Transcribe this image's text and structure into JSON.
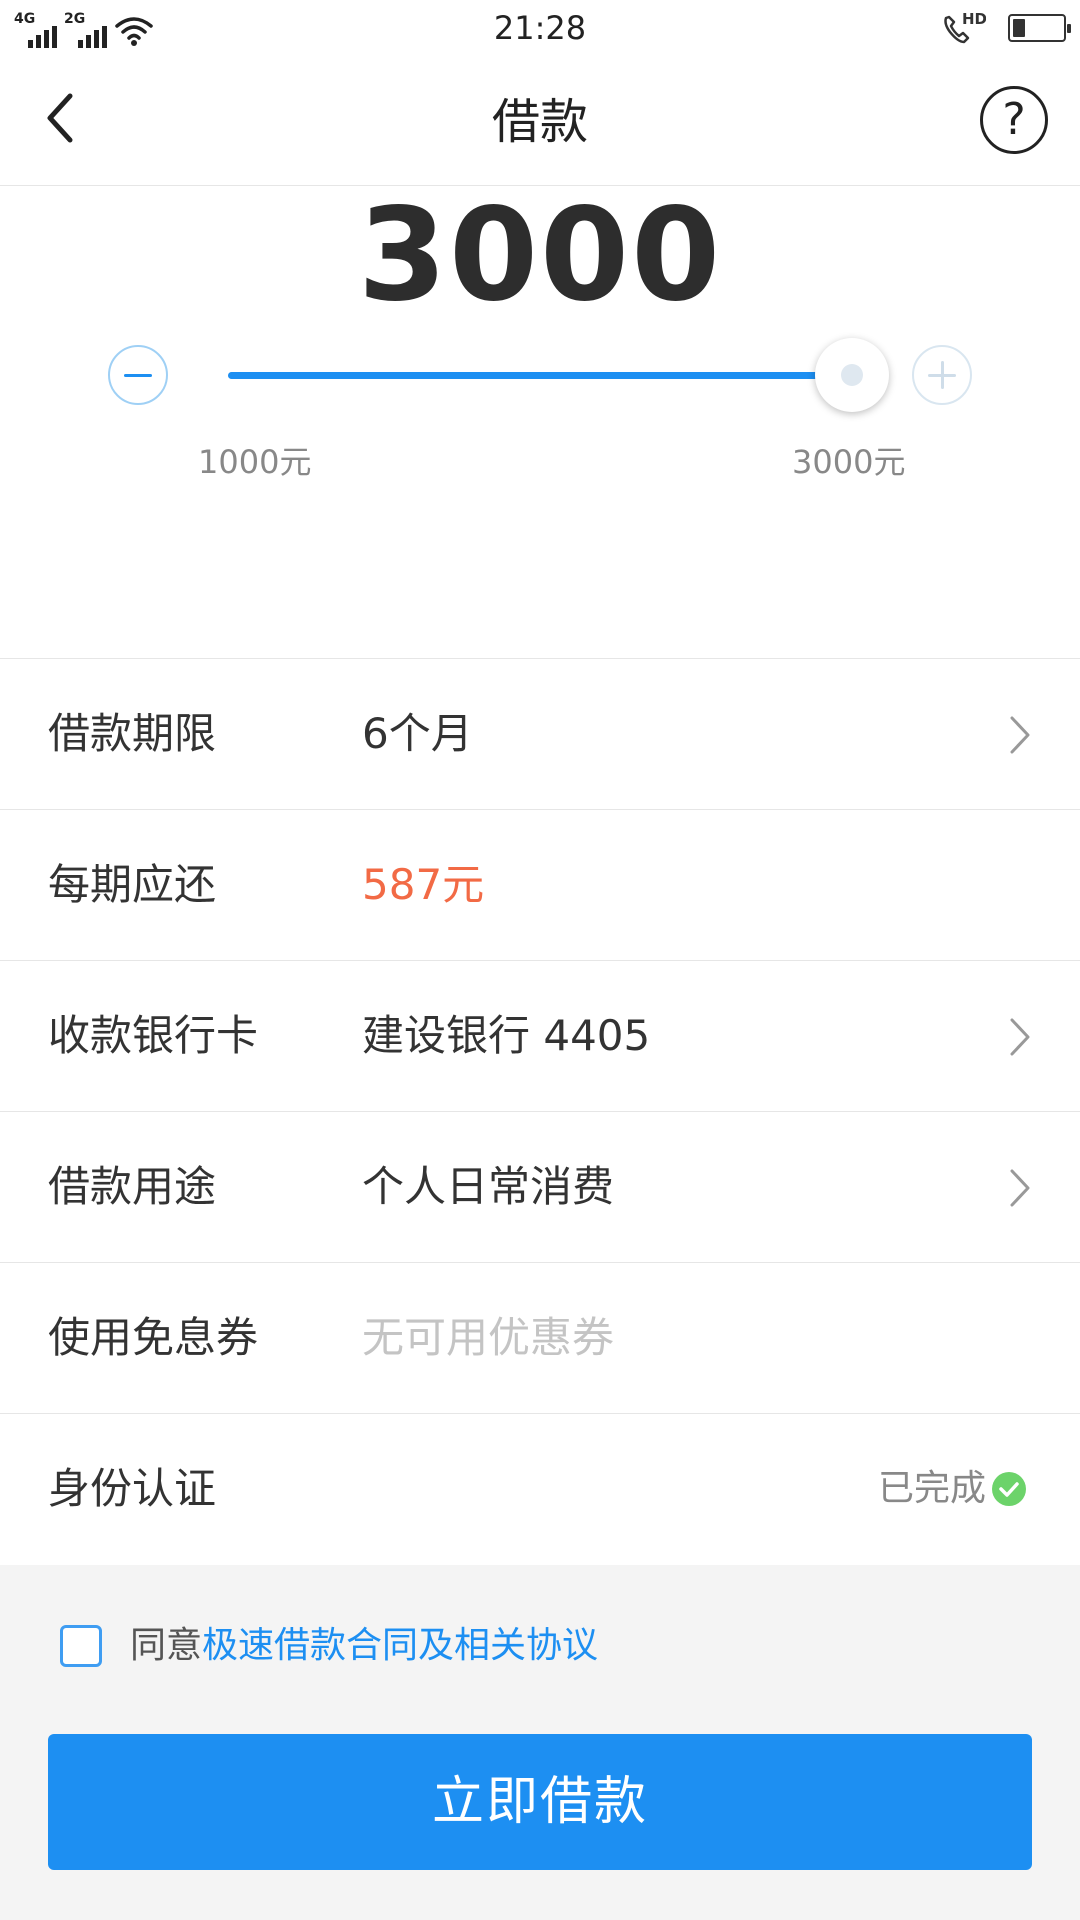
{
  "status_bar": {
    "network1": "4G",
    "network2": "2G",
    "time": "21:28",
    "hd_label": "HD",
    "battery_level": 0.25,
    "icons": [
      "signal-4g-icon",
      "signal-2g-icon",
      "wifi-icon",
      "hd-call-icon",
      "battery-icon"
    ]
  },
  "nav": {
    "back_icon": "chevron-left-icon",
    "title": "借款",
    "help_label": "?"
  },
  "loan_amount": {
    "value": "3000",
    "slider": {
      "min": 1000,
      "max": 3000,
      "current": 3000
    },
    "min_label": "1000元",
    "max_label": "3000元",
    "minus_icon": "minus-circle-icon",
    "plus_icon": "plus-circle-icon"
  },
  "rows": [
    {
      "label": "借款期限",
      "value": "6个月",
      "has_chevron": true
    },
    {
      "label": "每期应还",
      "value": "587元",
      "has_chevron": false,
      "value_color": "#f26a45"
    },
    {
      "label": "收款银行卡",
      "value": "建设银行 4405",
      "has_chevron": true
    },
    {
      "label": "借款用途",
      "value": "个人日常消费",
      "has_chevron": true
    },
    {
      "label": "使用免息券",
      "value": "无可用优惠券",
      "has_chevron": false,
      "placeholder": true
    },
    {
      "label": "身份认证",
      "status": "已完成",
      "status_icon": "check-circle-icon"
    }
  ],
  "agreement": {
    "checked": false,
    "prefix": "同意",
    "link_text": "极速借款合同及相关协议"
  },
  "submit_label": "立即借款",
  "colors": {
    "primary": "#1d8ff2",
    "amount_due": "#f26a45",
    "success": "#6cd36a",
    "bottom_bg": "#f4f4f4"
  }
}
